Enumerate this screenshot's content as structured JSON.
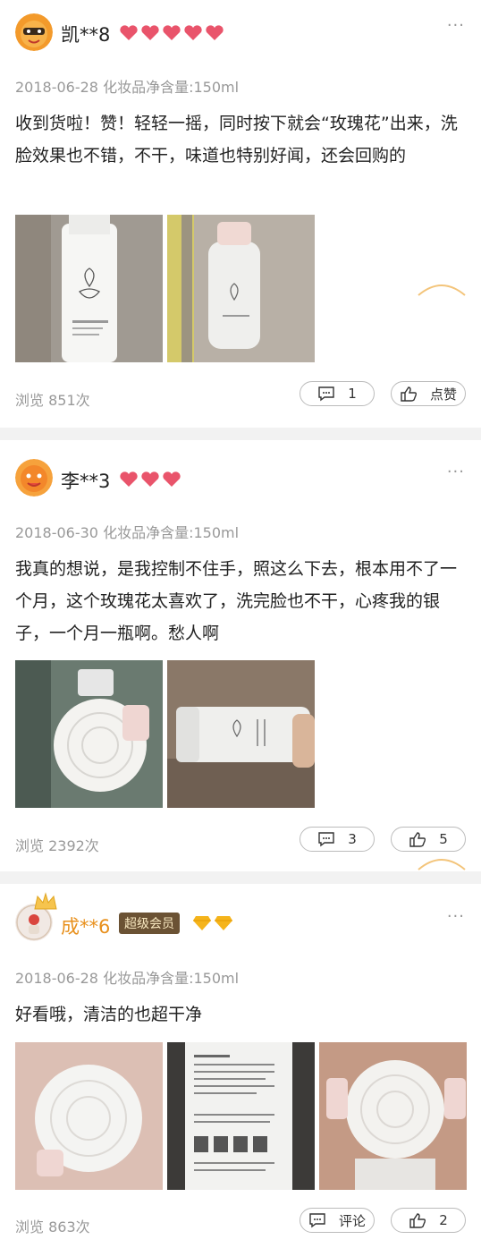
{
  "reviews": [
    {
      "username": "凯**8",
      "username_color": "#222222",
      "heart_count": 5,
      "date_spec": "2018-06-28 化妆品净含量:150ml",
      "content": "收到货啦！赞！轻轻一摇，同时按下就会“玫瑰花”出来，洗脸效果也不错，不干，味道也特别好闻，还会回购的",
      "photo_count": 2,
      "views": "浏览 851次",
      "comment_label": "1",
      "like_label": "点赞"
    },
    {
      "username": "李**3",
      "username_color": "#222222",
      "heart_count": 3,
      "date_spec": "2018-06-30 化妆品净含量:150ml",
      "content": "我真的想说，是我控制不住手，照这么下去，根本用不了一个月，这个玫瑰花太喜欢了，洗完脸也不干，心疼我的银子，一个月一瓶啊。愁人啊",
      "photo_count": 2,
      "views": "浏览 2392次",
      "comment_label": "3",
      "like_label": "5"
    },
    {
      "username": "成**6",
      "username_color": "#e8901c",
      "member_badge": "超级会员",
      "gem_count": 2,
      "date_spec": "2018-06-28 化妆品净含量:150ml",
      "content": "好看哦，清洁的也超干净",
      "photo_count": 3,
      "views": "浏览 863次",
      "comment_label": "评论",
      "like_label": "2"
    }
  ],
  "more_glyph": "···",
  "colors": {
    "heart": "#e9546b",
    "gem": "#f5b41b",
    "divider": "#f2f2f2"
  }
}
